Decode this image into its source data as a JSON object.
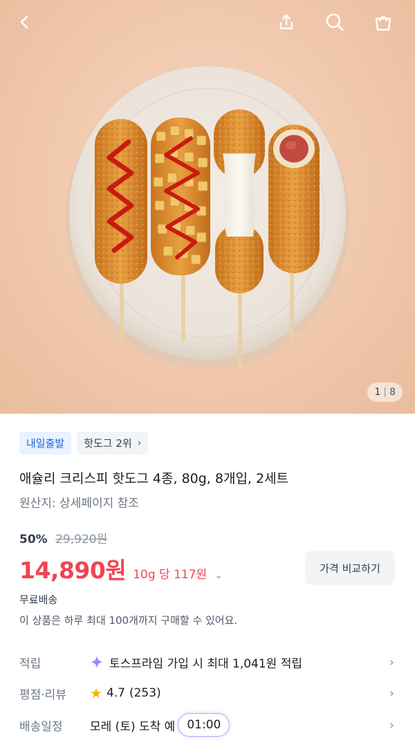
{
  "pager": {
    "current": "1",
    "total": "8"
  },
  "chips": {
    "tomorrow": "내일출발",
    "rank": "핫도그 2위"
  },
  "product": {
    "title": "애슐리 크리스피 핫도그 4종, 80g, 8개입, 2세트",
    "origin": "원산지: 상세페이지 참조",
    "discount": "50%",
    "original_price": "29,920원",
    "price": "14,890원",
    "unit_price": "10g 당 117원",
    "compare_label": "가격 비교하기",
    "free_shipping": "무료배송",
    "purchase_limit": "이 상품은 하루 최대 100개까지 구매할 수 있어요."
  },
  "rows": {
    "points": {
      "label": "적립",
      "value": "토스프라임 가입 시 최대 1,041원 적립"
    },
    "rating": {
      "label": "평점·리뷰",
      "score": "4.7",
      "count": "(253)"
    },
    "delivery": {
      "label": "배송일정",
      "value": "모레 (토) 도착 예",
      "time": "01:00"
    }
  },
  "icons": {
    "back": "chevron-left-icon",
    "share": "share-icon",
    "search": "search-icon",
    "cart": "shopping-bag-icon",
    "points": "sparkle-icon",
    "rating": "star-icon"
  },
  "colors": {
    "price": "#f04452",
    "badge_blue": "#1b64da",
    "badge_blue_bg": "#e8f3ff",
    "star": "#f5b400"
  }
}
